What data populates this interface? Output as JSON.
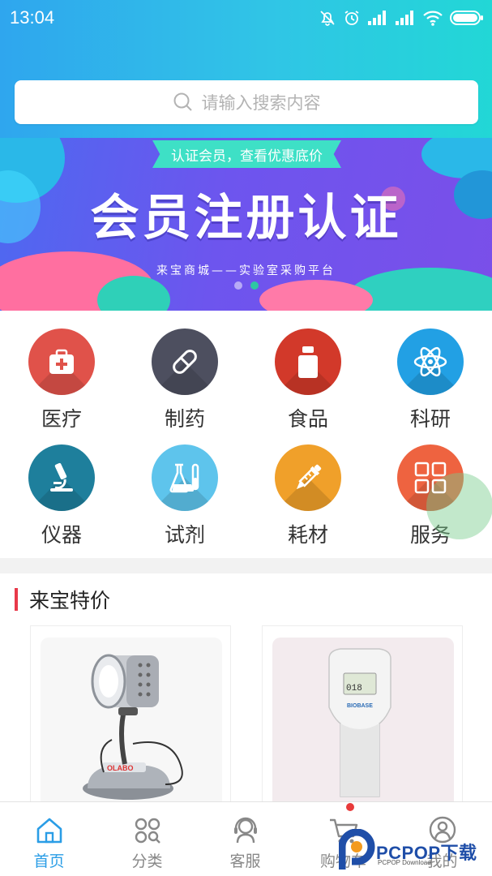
{
  "status_bar": {
    "time": "13:04"
  },
  "search": {
    "placeholder": "请输入搜索内容"
  },
  "banner": {
    "ribbon": "认证会员，查看优惠底价",
    "title": "会员注册认证",
    "subtitle": "来宝商城——实验室采购平台",
    "slide_count": 2,
    "active_slide": 2
  },
  "categories": [
    {
      "label": "医疗",
      "icon": "medical-kit-icon",
      "color": "#e0524a"
    },
    {
      "label": "制药",
      "icon": "pill-icon",
      "color": "#4d4f5f"
    },
    {
      "label": "食品",
      "icon": "bottle-icon",
      "color": "#d2392a"
    },
    {
      "label": "科研",
      "icon": "atom-icon",
      "color": "#22a0e4"
    },
    {
      "label": "仪器",
      "icon": "microscope-icon",
      "color": "#1e7f9c"
    },
    {
      "label": "试剂",
      "icon": "flask-icon",
      "color": "#5ec4ec"
    },
    {
      "label": "耗材",
      "icon": "pipette-icon",
      "color": "#f0a02a"
    },
    {
      "label": "服务",
      "icon": "grid-icon",
      "color": "#ee6340"
    }
  ],
  "specials": {
    "title": "来宝特价"
  },
  "products": [
    {
      "name": "lamp-heater-product-image",
      "brand_text": "OLABO"
    },
    {
      "name": "pipette-controller-product-image",
      "brand_text": "BIOBASE",
      "screen_text": "018"
    }
  ],
  "tabbar": {
    "items": [
      {
        "label": "首页",
        "icon": "home-icon",
        "active": true
      },
      {
        "label": "分类",
        "icon": "category-icon",
        "active": false
      },
      {
        "label": "客服",
        "icon": "customer-service-icon",
        "active": false
      },
      {
        "label": "购物车",
        "icon": "cart-icon",
        "active": false
      },
      {
        "label": "我的",
        "icon": "profile-icon",
        "active": false
      }
    ]
  },
  "watermark": {
    "text": "PCPOP下载",
    "sub": "PCPOP Download"
  },
  "colors": {
    "accent": "#2a9de6",
    "section_bar": "#e8394a"
  }
}
